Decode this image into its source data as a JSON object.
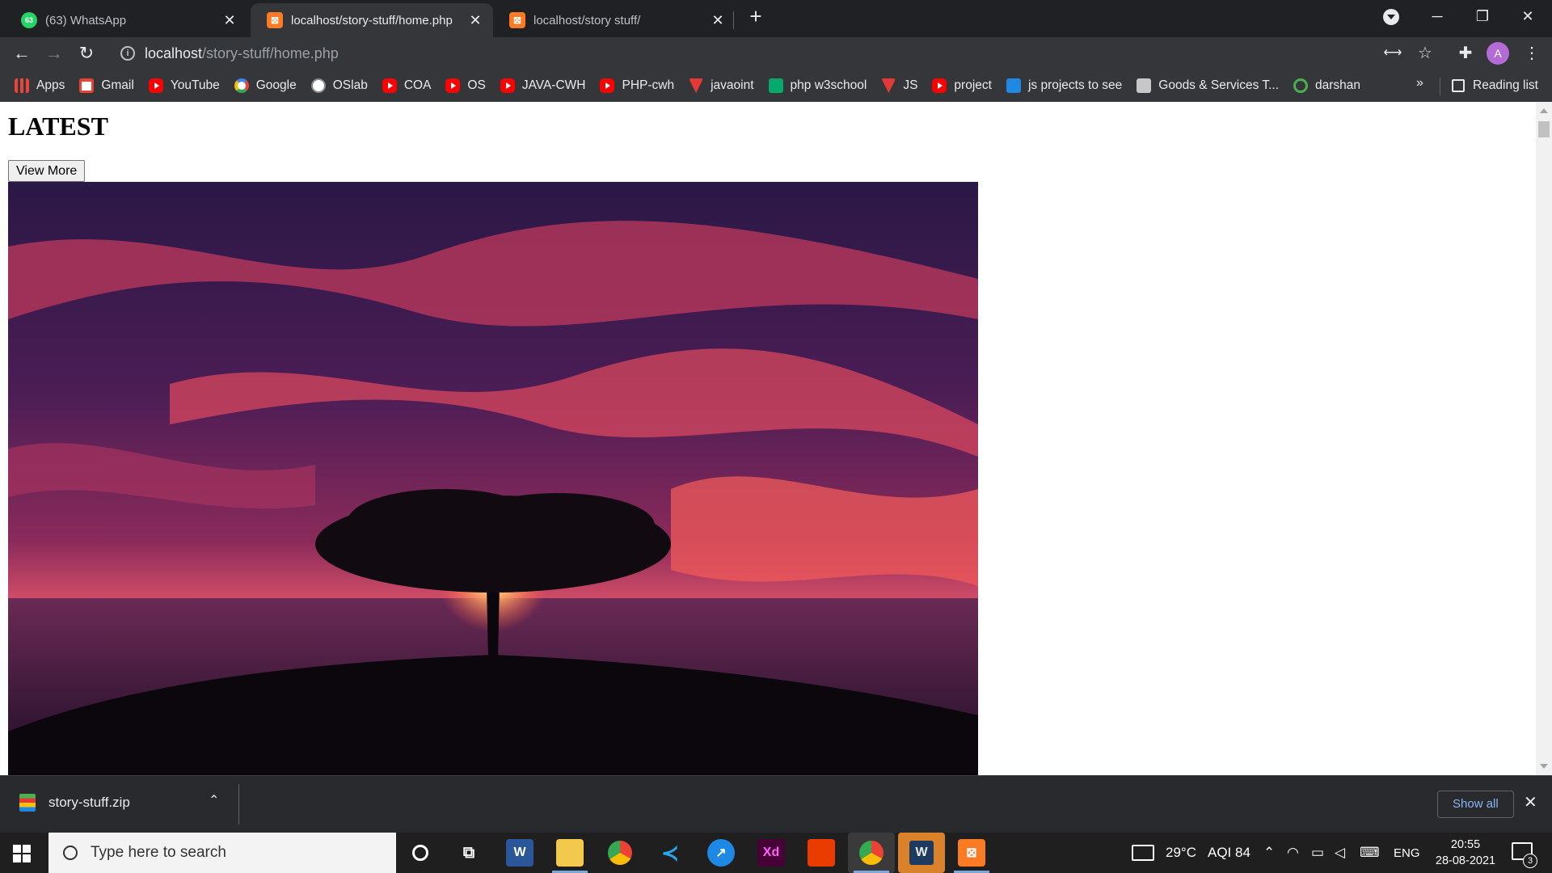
{
  "browser": {
    "tabs": [
      {
        "title": "(63) WhatsApp",
        "badge": "63",
        "favicon": "whatsapp-icon",
        "color": "#25d366"
      },
      {
        "title": "localhost/story-stuff/home.php",
        "favicon": "xampp-icon",
        "color": "#fb7a24"
      },
      {
        "title": "localhost/story stuff/",
        "favicon": "xampp-icon",
        "color": "#fb7a24"
      }
    ],
    "new_tab": "+",
    "address": {
      "host": "localhost",
      "path": "/story-stuff/home.php",
      "info": "i"
    },
    "avatar_initial": "A"
  },
  "bookmarks": {
    "items": [
      {
        "label": "Apps",
        "icon": "apps-grid-icon"
      },
      {
        "label": "Gmail",
        "icon": "gmail-icon"
      },
      {
        "label": "YouTube",
        "icon": "youtube-icon"
      },
      {
        "label": "Google",
        "icon": "google-icon"
      },
      {
        "label": "OSlab",
        "icon": "oslab-icon"
      },
      {
        "label": "COA",
        "icon": "youtube-icon"
      },
      {
        "label": "OS",
        "icon": "youtube-icon"
      },
      {
        "label": "JAVA-CWH",
        "icon": "youtube-icon"
      },
      {
        "label": "PHP-cwh",
        "icon": "youtube-icon"
      },
      {
        "label": "javaoint",
        "icon": "javatpoint-icon"
      },
      {
        "label": "php w3school",
        "icon": "w3schools-icon"
      },
      {
        "label": "JS",
        "icon": "javatpoint-icon"
      },
      {
        "label": "project",
        "icon": "youtube-icon"
      },
      {
        "label": "js projects to see",
        "icon": "bookmark-site-icon"
      },
      {
        "label": "Goods & Services T...",
        "icon": "bookmark-site-icon"
      },
      {
        "label": "darshan",
        "icon": "darshan-icon"
      }
    ],
    "more": "»",
    "reading_list": "Reading list"
  },
  "page": {
    "heading": "LATEST",
    "view_more": "View More",
    "image": "sunset-tree-over-sea"
  },
  "downloads": {
    "file": "story-stuff.zip",
    "show_all": "Show all"
  },
  "taskbar": {
    "search_placeholder": "Type here to search",
    "apps": [
      "cortana-icon",
      "task-view-icon",
      "word-icon",
      "file-explorer-icon",
      "chrome-icon",
      "vscode-icon",
      "app-icon",
      "adobe-xd-icon",
      "office-icon",
      "chrome-profile-icon",
      "wamp-icon",
      "xampp-icon"
    ],
    "weather": "29°C",
    "aqi": "AQI 84",
    "language": "ENG",
    "time": "20:55",
    "date": "28-08-2021",
    "notifications": "3"
  },
  "colors": {
    "chrome_dark": "#202124",
    "chrome_toolbar": "#35363a",
    "link_blue": "#8ab4f8"
  }
}
